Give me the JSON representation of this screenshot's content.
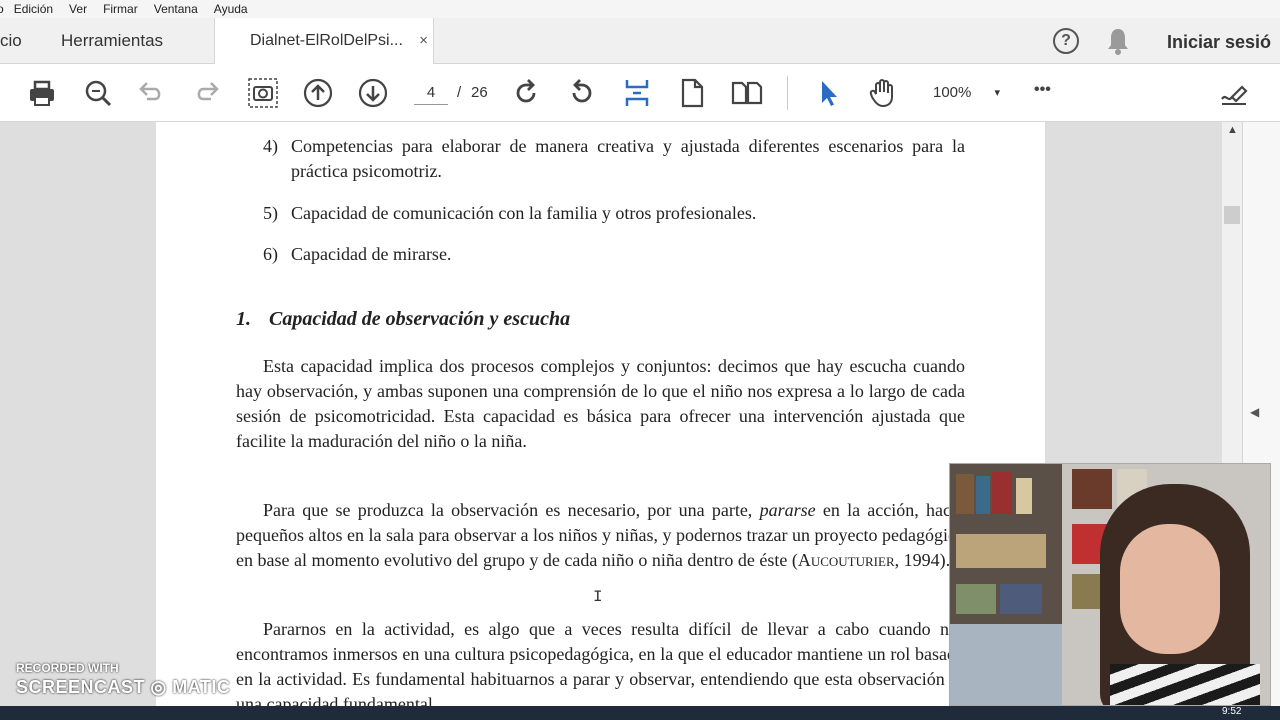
{
  "menubar": {
    "items": [
      "o",
      "Edición",
      "Ver",
      "Firmar",
      "Ventana",
      "Ayuda"
    ]
  },
  "tabs": {
    "inicio": "cio",
    "herramientas": "Herramientas",
    "document": "Dialnet-ElRolDelPsi...",
    "close_glyph": "×"
  },
  "header": {
    "signin": "Iniciar sesió",
    "help_glyph": "?"
  },
  "toolbar": {
    "current_page": "4",
    "separator": "/",
    "total_pages": "26",
    "zoom": "100%",
    "zoom_arrow": "▾",
    "more_glyph": "•••"
  },
  "document": {
    "list_items": [
      {
        "num": "4)",
        "text": "Competencias para elaborar de manera creativa y ajustada diferentes escenarios para la práctica psicomotriz."
      },
      {
        "num": "5)",
        "text": "Capacidad de comunicación con la familia y otros profesionales."
      },
      {
        "num": "6)",
        "text": "Capacidad de mirarse."
      }
    ],
    "heading_num": "1.",
    "heading_text": "Capacidad de observación y escucha",
    "para1": "Esta capacidad implica dos procesos complejos y conjuntos: decimos que hay escucha cuando hay observación, y ambas suponen una comprensión de lo que el niño nos expresa a lo largo de cada sesión de psicomotricidad. Esta capacidad es básica para ofrecer una intervención ajustada que facilite la maduración del niño o la niña.",
    "para2_a": "Para que se produzca la observación es necesario, por una parte, ",
    "para2_em": "pararse",
    "para2_b": " en la acción, hacer pequeños altos en la sala para observar a los niños y niñas, y podernos trazar un proyecto pedagógico en base al momento evolutivo del grupo y de cada niño o niña dentro de éste (",
    "para2_sc": "Aucouturier",
    "para2_c": ", 1994).",
    "para3": "Pararnos en la actividad, es algo que a veces resulta difícil de llevar a cabo cuando nos encontramos inmersos en una cultura psicopedagógica, en la que el educador mantiene un rol basado en la actividad. Es fundamental habituarnos a parar y observar, entendiendo que esta observación es una capacidad fundamental"
  },
  "viewer": {
    "cursor_glyph": "I",
    "scroll_up_glyph": "▲",
    "collapse_glyph": "◀"
  },
  "watermark": {
    "line1": "RECORDED WITH",
    "line2": "SCREENCAST ◎ MATIC"
  },
  "taskbar": {
    "clock": "9:52"
  },
  "colors": {
    "accent_blue": "#2a6cc4",
    "icon_gray": "#444444"
  }
}
